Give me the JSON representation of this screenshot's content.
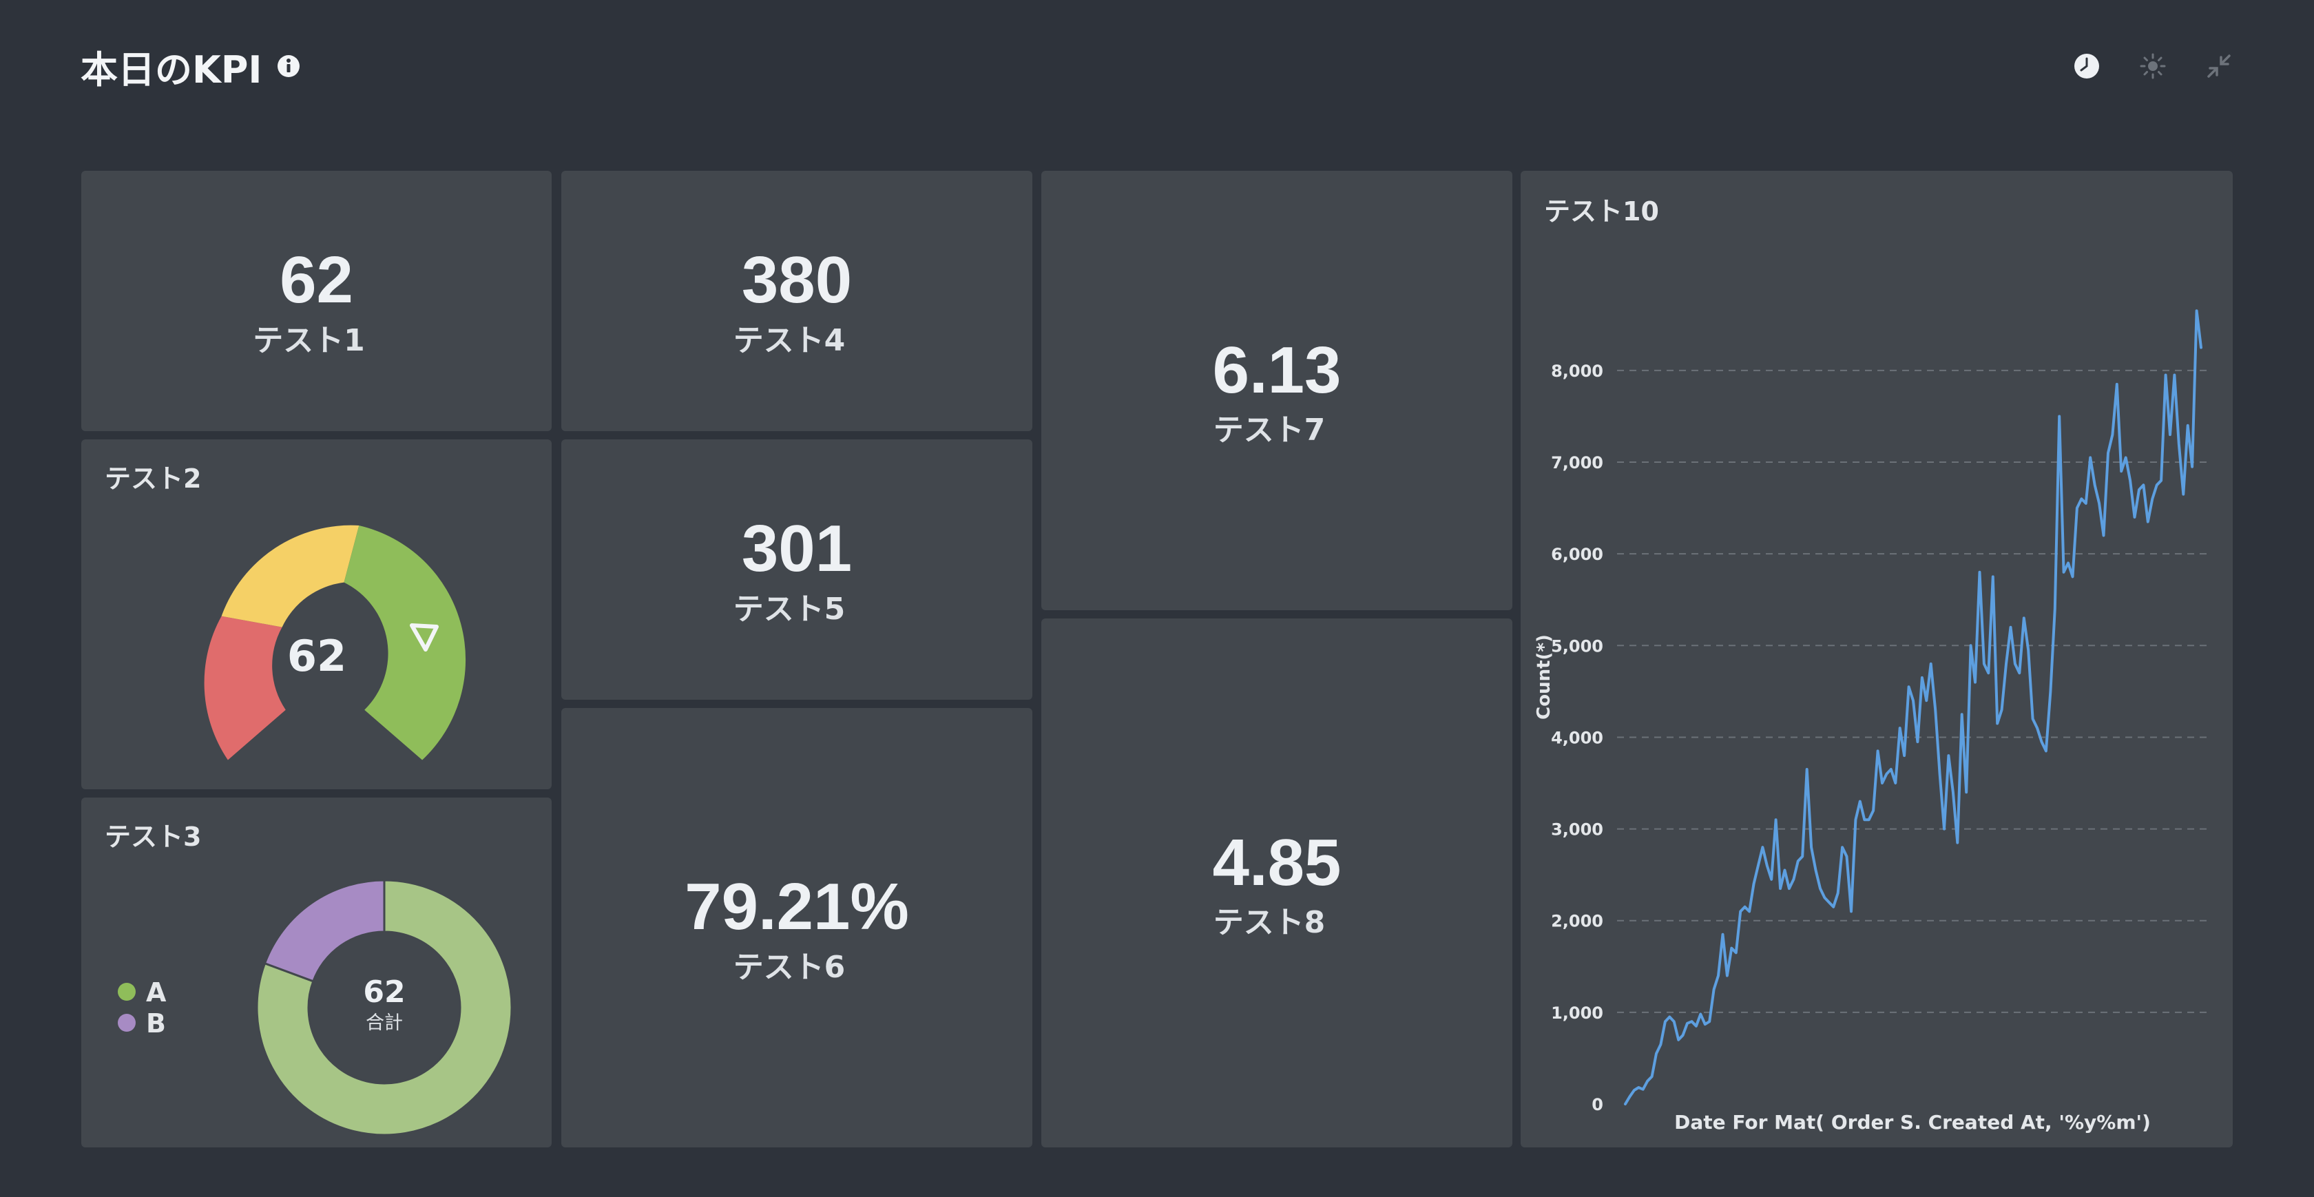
{
  "header": {
    "title": "本日のKPI",
    "icons": [
      "info-icon",
      "clock-icon",
      "brightness-icon",
      "collapse-icon"
    ]
  },
  "cards": {
    "test1": {
      "value": "62",
      "label": "テスト1"
    },
    "test2": {
      "title": "テスト2",
      "value": "62",
      "segment_colors": [
        "#e06c6c",
        "#f5d066",
        "#8fbd5a"
      ]
    },
    "test3": {
      "title": "テスト3",
      "center_value": "62",
      "center_label": "合計",
      "legend": [
        {
          "label": "A",
          "color": "#8fbd5a"
        },
        {
          "label": "B",
          "color": "#a78bc4"
        }
      ]
    },
    "test4": {
      "value": "380",
      "label": "テスト4"
    },
    "test5": {
      "value": "301",
      "label": "テスト5"
    },
    "test6": {
      "value": "79.21%",
      "label": "テスト6"
    },
    "test7": {
      "value": "6.13",
      "label": "テスト7"
    },
    "test8": {
      "value": "4.85",
      "label": "テスト8"
    },
    "test10": {
      "title": "テスト10"
    }
  },
  "chart_data": [
    {
      "type": "pie",
      "categories": [
        "A",
        "B"
      ],
      "values": [
        50,
        12
      ],
      "colors": [
        "#a7c586",
        "#a78bc4"
      ]
    },
    {
      "type": "line",
      "title": "テスト10",
      "xlabel": "Date For Mat( Order S. Created At, '%y%m')",
      "ylabel": "Count(*)",
      "ylim": [
        0,
        8600
      ],
      "yticks": [
        0,
        1000,
        2000,
        3000,
        4000,
        5000,
        6000,
        7000,
        8000
      ],
      "ytick_labels": [
        "0",
        "1,000",
        "2,000",
        "3,000",
        "4,000",
        "5,000",
        "6,000",
        "7,000",
        "8,000"
      ],
      "grid": true,
      "line_color": "#5d9fe0",
      "series": [
        {
          "values": [
            0,
            80,
            150,
            180,
            160,
            250,
            300,
            550,
            650,
            900,
            950,
            900,
            700,
            750,
            880,
            900,
            850,
            980,
            870,
            900,
            1250,
            1400,
            1850,
            1400,
            1700,
            1650,
            2100,
            2150,
            2100,
            2400,
            2600,
            2800,
            2600,
            2450,
            3100,
            2350,
            2550,
            2350,
            2450,
            2650,
            2700,
            3650,
            2800,
            2550,
            2350,
            2250,
            2200,
            2150,
            2300,
            2800,
            2700,
            2100,
            3100,
            3300,
            3100,
            3100,
            3200,
            3850,
            3500,
            3600,
            3650,
            3500,
            4100,
            3800,
            4550,
            4400,
            3950,
            4650,
            4400,
            4800,
            4300,
            3600,
            3000,
            3800,
            3400,
            2850,
            4250,
            3400,
            5000,
            4600,
            5800,
            4800,
            4700,
            5750,
            4150,
            4300,
            4800,
            5200,
            4800,
            4700,
            5300,
            4950,
            4200,
            4100,
            3950,
            3850,
            4500,
            5400,
            7500,
            5800,
            5900,
            5750,
            6500,
            6600,
            6550,
            7050,
            6750,
            6550,
            6200,
            7100,
            7300,
            7850,
            6900,
            7050,
            6800,
            6400,
            6700,
            6750,
            6350,
            6600,
            6750,
            6800,
            7950,
            7300,
            7950,
            7200,
            6650,
            7400,
            6950,
            8650,
            8250
          ]
        }
      ]
    }
  ]
}
